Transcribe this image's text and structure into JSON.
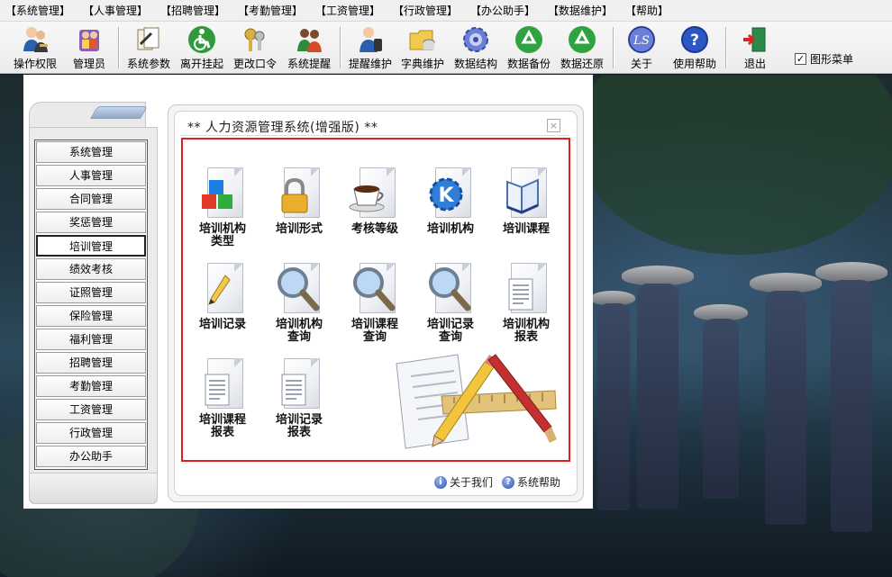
{
  "menu": [
    "【系统管理】",
    "【人事管理】",
    "【招聘管理】",
    "【考勤管理】",
    "【工资管理】",
    "【行政管理】",
    "【办公助手】",
    "【数据维护】",
    "【帮助】"
  ],
  "toolbar": [
    {
      "label": "操作权限",
      "icon": "users-key-icon"
    },
    {
      "label": "管理员",
      "icon": "admin-users-icon"
    },
    {
      "label": "系统参数",
      "icon": "documents-icon"
    },
    {
      "label": "离开挂起",
      "icon": "wheelchair-icon"
    },
    {
      "label": "更改口令",
      "icon": "keys-icon"
    },
    {
      "label": "系统提醒",
      "icon": "people-alert-icon"
    },
    {
      "label": "提醒维护",
      "icon": "person-phone-icon"
    },
    {
      "label": "字典维护",
      "icon": "folder-db-icon"
    },
    {
      "label": "数据结构",
      "icon": "gear-icon"
    },
    {
      "label": "数据备份",
      "icon": "recycle-icon"
    },
    {
      "label": "数据还原",
      "icon": "recycle-icon"
    },
    {
      "label": "关于",
      "icon": "about-logo-icon"
    },
    {
      "label": "使用帮助",
      "icon": "help-icon"
    },
    {
      "label": "退出",
      "icon": "exit-door-icon"
    }
  ],
  "graphic_menu": {
    "label": "图形菜单",
    "checked": true,
    "check_mark": "✓"
  },
  "sidebar": {
    "items": [
      "系统管理",
      "人事管理",
      "合同管理",
      "奖惩管理",
      "培训管理",
      "绩效考核",
      "证照管理",
      "保险管理",
      "福利管理",
      "招聘管理",
      "考勤管理",
      "工资管理",
      "行政管理",
      "办公助手"
    ],
    "active_index": 4
  },
  "content": {
    "title": "**  人力资源管理系统(增强版)  **",
    "close_glyph": "×",
    "items": [
      {
        "label": "培训机构\n类型",
        "icon": "cubes-icon"
      },
      {
        "label": "培训形式",
        "icon": "lock-icon"
      },
      {
        "label": "考核等级",
        "icon": "coffee-cup-icon"
      },
      {
        "label": "培训机构",
        "icon": "kde-gear-icon"
      },
      {
        "label": "培训课程",
        "icon": "open-book-icon"
      },
      {
        "label": "培训记录",
        "icon": "pencil-doc-icon"
      },
      {
        "label": "培训机构\n查询",
        "icon": "magnifier-icon"
      },
      {
        "label": "培训课程\n查询",
        "icon": "magnifier-icon"
      },
      {
        "label": "培训记录\n查询",
        "icon": "magnifier-icon"
      },
      {
        "label": "培训机构\n报表",
        "icon": "report-doc-icon"
      },
      {
        "label": "培训课程\n报表",
        "icon": "report-doc-icon"
      },
      {
        "label": "培训记录\n报表",
        "icon": "report-doc-icon"
      }
    ]
  },
  "footer_links": [
    {
      "label": "关于我们",
      "icon": "about-icon",
      "glyph": "i"
    },
    {
      "label": "系统帮助",
      "icon": "help-icon",
      "glyph": "?"
    }
  ],
  "colors": {
    "accent_red": "#e02020",
    "panel_bg": "#ffffff"
  }
}
